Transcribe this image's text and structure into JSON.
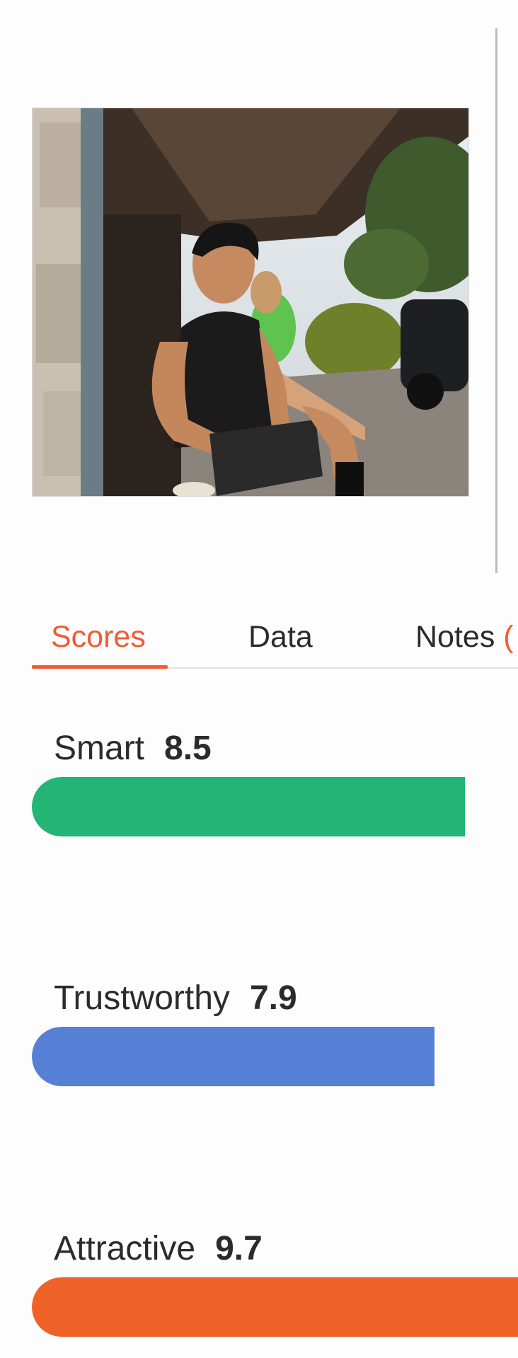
{
  "tabs": [
    {
      "label": "Scores",
      "active": true
    },
    {
      "label": "Data",
      "active": false
    },
    {
      "label": "Notes",
      "active": false,
      "suffix": "("
    }
  ],
  "scores": [
    {
      "label": "Smart",
      "value": "8.5",
      "color": "#22b573"
    },
    {
      "label": "Trustworthy",
      "value": "7.9",
      "color": "#5580d6"
    },
    {
      "label": "Attractive",
      "value": "9.7",
      "color": "#ef6228"
    }
  ],
  "colors": {
    "accent": "#f15a33"
  }
}
